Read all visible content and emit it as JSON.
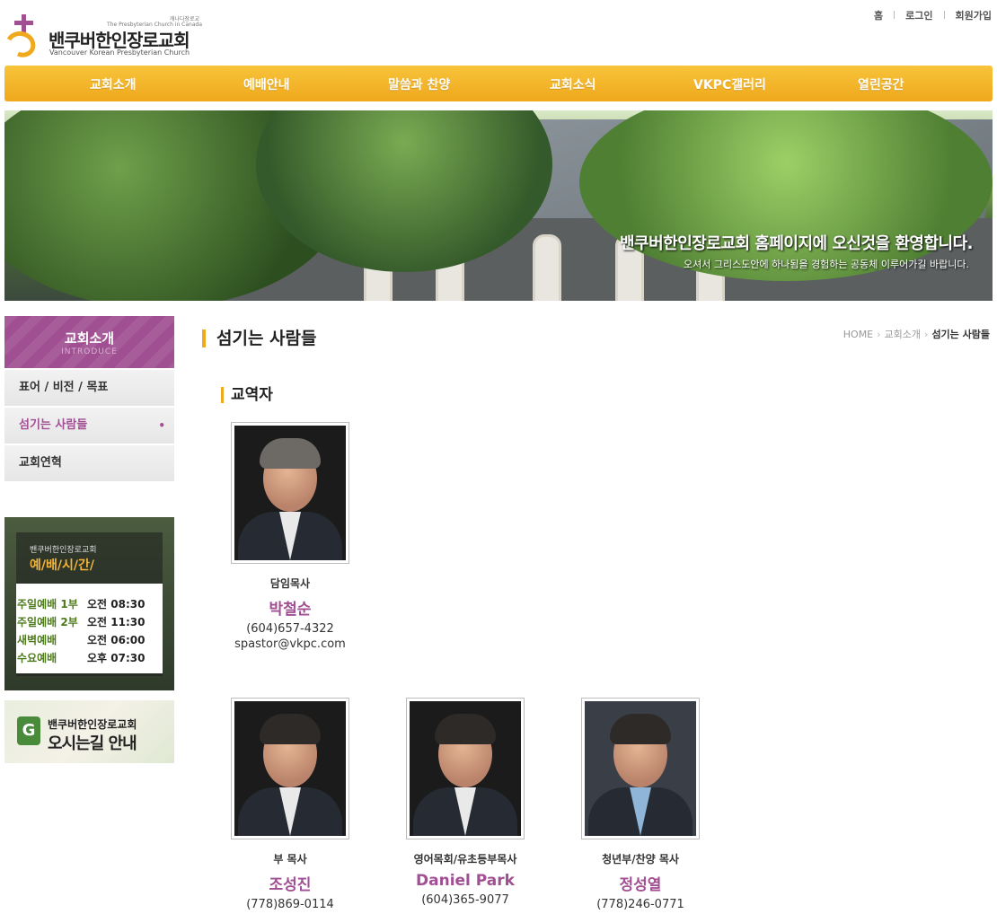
{
  "header": {
    "logo_small": "캐나다장로교",
    "logo_en_top": "The Presbyterian Church in Canada",
    "logo_ko": "밴쿠버한인장로교회",
    "logo_en": "Vancouver Korean Presbyterian Church",
    "util": [
      "홈",
      "로그인",
      "회원가입"
    ]
  },
  "gnb": [
    "교회소개",
    "예배안내",
    "말씀과 찬양",
    "교회소식",
    "VKPC갤러리",
    "열린공간"
  ],
  "visual": {
    "msg1": "밴쿠버한인장로교회 홈페이지에 오신것을 환영합니다.",
    "msg2": "오셔서 그리스도안에 하나됨을 경험하는 공동체 이루어가길 바랍니다."
  },
  "lnb": {
    "title": "교회소개",
    "subtitle": "INTRODUCE",
    "items": [
      "표어 / 비전 / 목표",
      "섬기는 사람들",
      "교회연혁"
    ],
    "active_marker": "•"
  },
  "worship": {
    "church": "밴쿠버한인장로교회",
    "title": "예/배/시/간/",
    "rows": [
      {
        "name": "주일예배 1부",
        "time": "오전 08:30"
      },
      {
        "name": "주일예배 2부",
        "time": "오전 11:30"
      },
      {
        "name": "새벽예배",
        "time": "오전 06:00"
      },
      {
        "name": "수요예배",
        "time": "오후 07:30"
      }
    ]
  },
  "map": {
    "icon": "G",
    "line1": "밴쿠버한인장로교회",
    "line2": "오시는길 안내"
  },
  "content": {
    "page_title": "섬기는 사람들",
    "breadcrumb": [
      "HOME",
      "교회소개",
      "섬기는 사람들"
    ],
    "section_title": "교역자",
    "people": [
      {
        "role": "담임목사",
        "name": "박철순",
        "tel": "(604)657-4322",
        "email": "spastor@vkpc.com"
      },
      {
        "role": "부 목사",
        "name": "조성진",
        "tel": "(778)869-0114",
        "email": ""
      },
      {
        "role": "영어목회/유초등부목사",
        "name": "Daniel Park",
        "tel": "(604)365-9077",
        "email": ""
      },
      {
        "role": "청년부/찬양 목사",
        "name": "정성열",
        "tel": "(778)246-0771",
        "email": ""
      }
    ]
  },
  "colors": {
    "accent": "#f0a81c",
    "brand": "#a14f93",
    "green": "#4d7a1b"
  }
}
